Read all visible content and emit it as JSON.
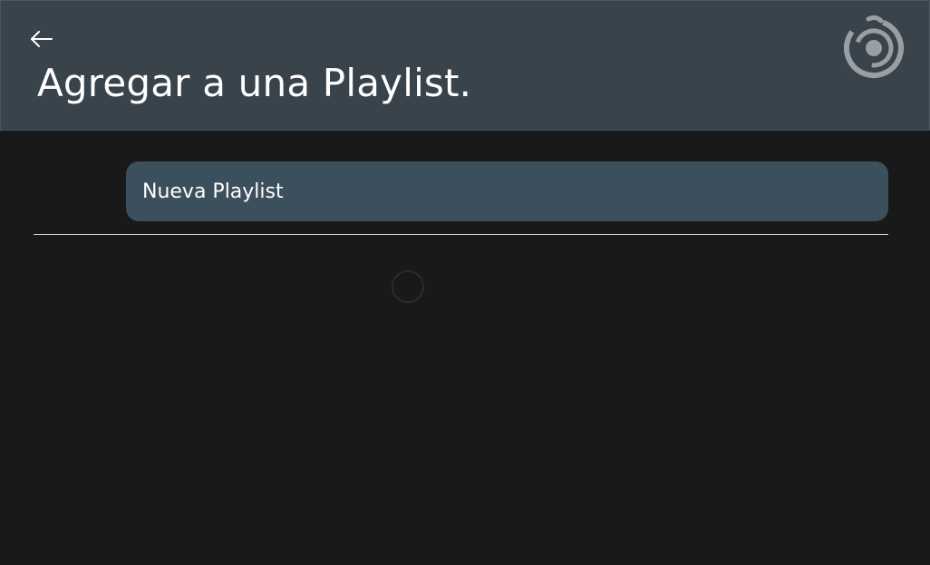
{
  "header": {
    "back_icon": "arrow-left-icon",
    "title": "Agregar a una Playlist.",
    "logo_icon": "app-logo-icon",
    "background_color": "#38434c"
  },
  "main": {
    "new_playlist_label": "Nueva Playlist",
    "button_color": "#3c4f5c",
    "loading_indicator": "loading-spinner-icon"
  }
}
